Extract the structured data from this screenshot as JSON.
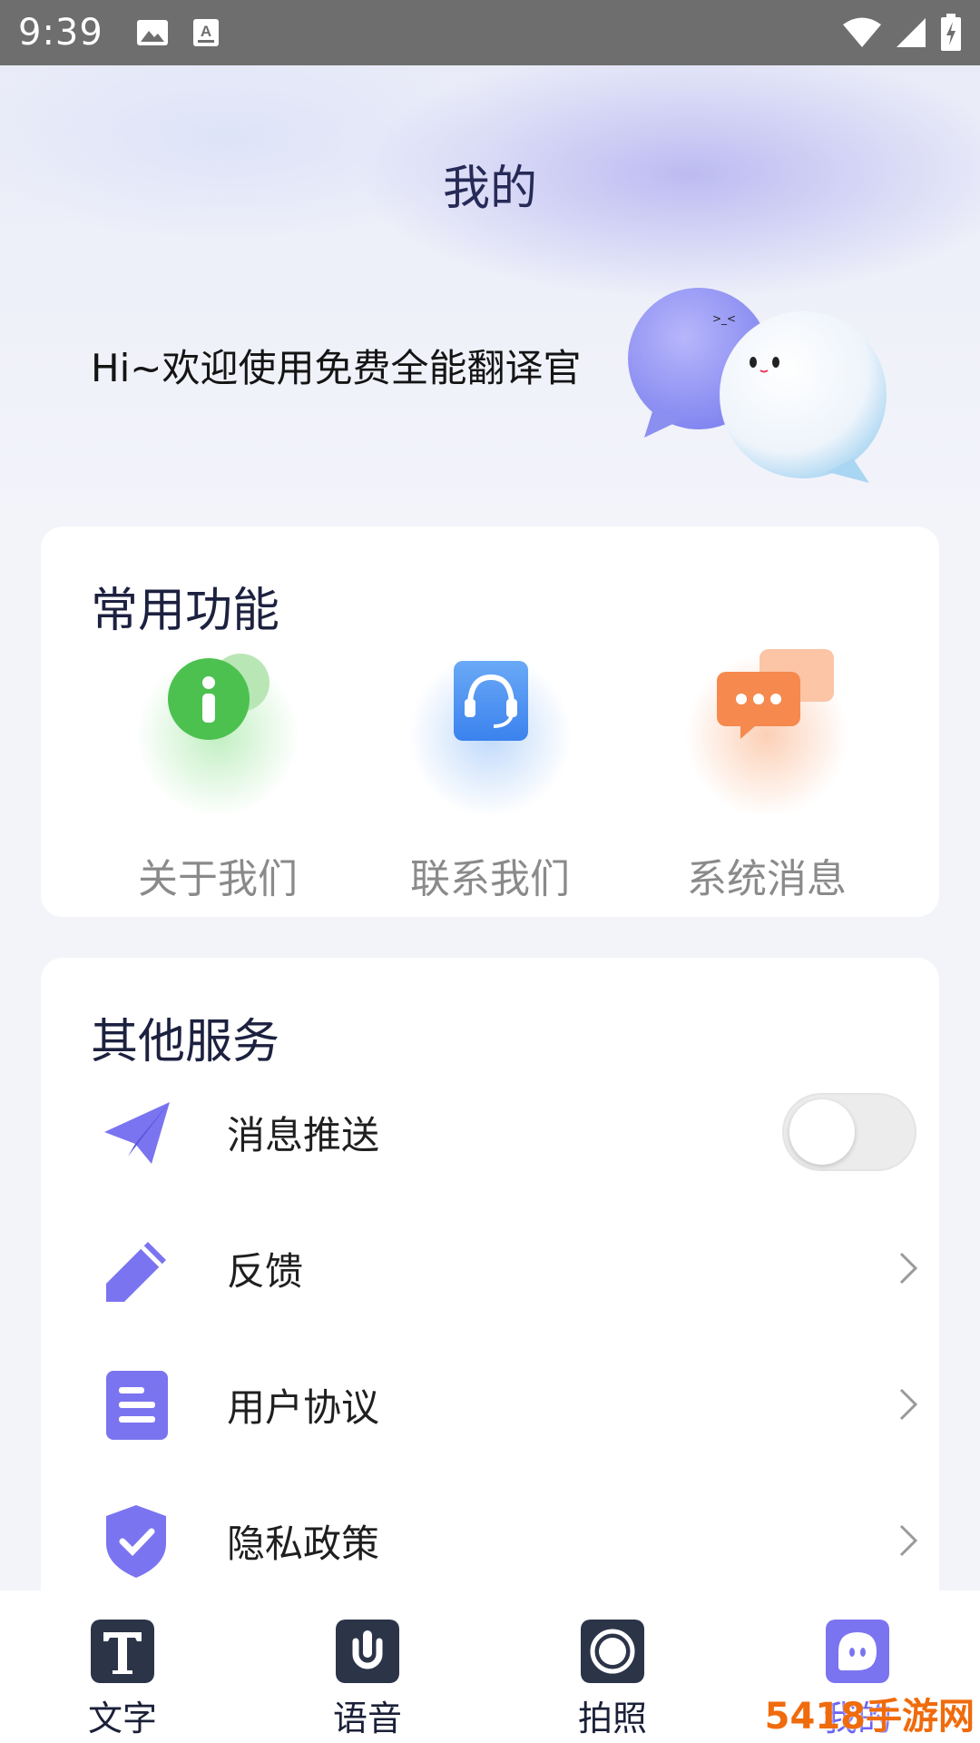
{
  "status_bar": {
    "time": "9:39",
    "icons_left": [
      "image-icon",
      "keyboard-a-icon"
    ],
    "icons_right": [
      "wifi-icon",
      "signal-icon",
      "battery-charging-icon"
    ]
  },
  "header": {
    "title": "我的",
    "greeting": "Hi~欢迎使用免费全能翻译官"
  },
  "common_functions": {
    "title": "常用功能",
    "items": [
      {
        "label": "关于我们",
        "icon": "info-icon",
        "color": "#4cc14f"
      },
      {
        "label": "联系我们",
        "icon": "headset-icon",
        "color": "#3d8ef0"
      },
      {
        "label": "系统消息",
        "icon": "chat-bubbles-icon",
        "color": "#f5894e"
      }
    ]
  },
  "other_services": {
    "title": "其他服务",
    "items": [
      {
        "label": "消息推送",
        "icon": "paper-plane-icon",
        "control": "toggle",
        "toggle_on": false
      },
      {
        "label": "反馈",
        "icon": "pencil-icon",
        "control": "chevron"
      },
      {
        "label": "用户协议",
        "icon": "document-icon",
        "control": "chevron"
      },
      {
        "label": "隐私政策",
        "icon": "shield-check-icon",
        "control": "chevron"
      }
    ]
  },
  "bottom_nav": {
    "items": [
      {
        "label": "文字",
        "icon": "text-icon",
        "active": false
      },
      {
        "label": "语音",
        "icon": "microphone-icon",
        "active": false
      },
      {
        "label": "拍照",
        "icon": "camera-icon",
        "active": false
      },
      {
        "label": "我的",
        "icon": "profile-icon",
        "active": true
      }
    ]
  },
  "watermark": "5418手游网",
  "colors": {
    "accent": "#6a63f0",
    "icon_purple": "#7b74f0",
    "title_navy": "#262a57"
  }
}
